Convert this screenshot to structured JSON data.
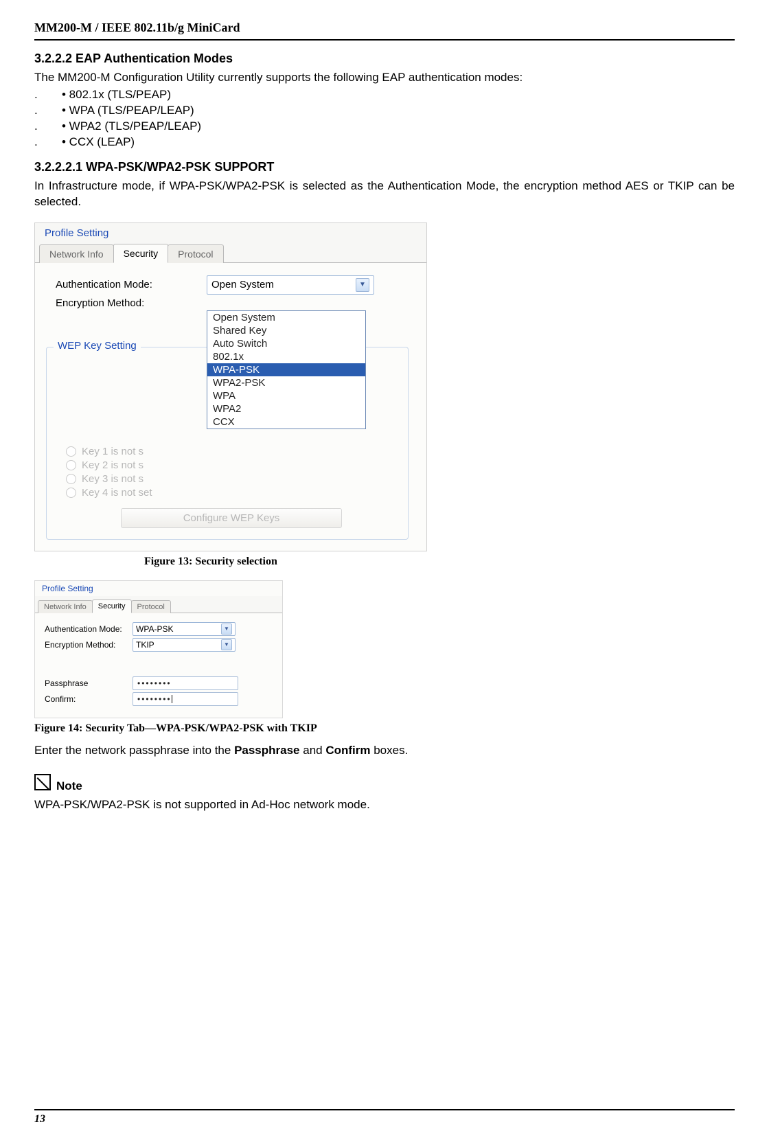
{
  "header": "MM200-M / IEEE 802.11b/g MiniCard",
  "section": {
    "h1": "3.2.2.2 EAP Authentication Modes",
    "intro": "The MM200-M Configuration Utility currently supports the following EAP authentication modes:",
    "bullets": [
      "• 802.1x (TLS/PEAP)",
      "• WPA (TLS/PEAP/LEAP)",
      "• WPA2 (TLS/PEAP/LEAP)",
      "• CCX (LEAP)"
    ],
    "h2": "3.2.2.2.1 WPA-PSK/WPA2-PSK SUPPORT",
    "para2": "In Infrastructure mode, if WPA-PSK/WPA2-PSK is selected as the Authentication Mode, the encryption method AES or TKIP can be selected."
  },
  "fig13": {
    "caption": "Figure 13: Security selection",
    "profileSetting": "Profile Setting",
    "tabs": {
      "networkInfo": "Network Info",
      "security": "Security",
      "protocol": "Protocol"
    },
    "authLabel": "Authentication Mode:",
    "encLabel": "Encryption Method:",
    "authValue": "Open System",
    "options": [
      "Open System",
      "Shared Key",
      "Auto Switch",
      "802.1x",
      "WPA-PSK",
      "WPA2-PSK",
      "WPA",
      "WPA2",
      "CCX"
    ],
    "selectedOption": "WPA-PSK",
    "wepTitle": "WEP Key Setting",
    "wepKeys": [
      "Key 1 is not s",
      "Key 2 is not s",
      "Key 3 is not s",
      "Key 4 is not set"
    ],
    "wepButton": "Configure WEP Keys"
  },
  "fig14": {
    "caption": "Figure 14: Security Tab—WPA-PSK/WPA2-PSK with TKIP",
    "profileSetting": "Profile Setting",
    "tabs": {
      "networkInfo": "Network Info",
      "security": "Security",
      "protocol": "Protocol"
    },
    "authLabel": "Authentication Mode:",
    "encLabel": "Encryption Method:",
    "authValue": "WPA-PSK",
    "encValue": "TKIP",
    "passLabel": "Passphrase",
    "confirmLabel": "Confirm:",
    "passValue": "••••••••",
    "confirmValue": "••••••••"
  },
  "postFig": {
    "enterText1": "Enter the network passphrase into the ",
    "passWord": "Passphrase",
    "andWord": " and ",
    "confirmWord": "Confirm",
    "enterText2": " boxes.",
    "noteLabel": "Note",
    "noteText": "WPA-PSK/WPA2-PSK is not supported in Ad-Hoc network mode."
  },
  "footer": "13"
}
